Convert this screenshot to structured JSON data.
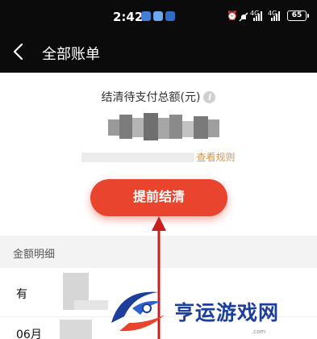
{
  "status_bar": {
    "time": "2:42",
    "network_1": "4G",
    "network_2": "4G",
    "battery": "65"
  },
  "header": {
    "title": "全部账单"
  },
  "summary": {
    "label": "结清待支付总额(元)",
    "info_symbol": "i",
    "rule_link": "查看规则"
  },
  "pay_button": {
    "label": "提前结清"
  },
  "details": {
    "section_title": "金额明细",
    "rows": [
      {
        "label": "有"
      },
      {
        "label": "06月"
      }
    ]
  },
  "watermark": {
    "text": "亨运游戏网",
    "sub": ".com"
  },
  "colors": {
    "header_bg": "#0b0b0b",
    "primary_button": "#e8442e",
    "rule_link": "#d8923f",
    "arrow": "#c81e1e",
    "watermark": "#1d3e9a"
  }
}
